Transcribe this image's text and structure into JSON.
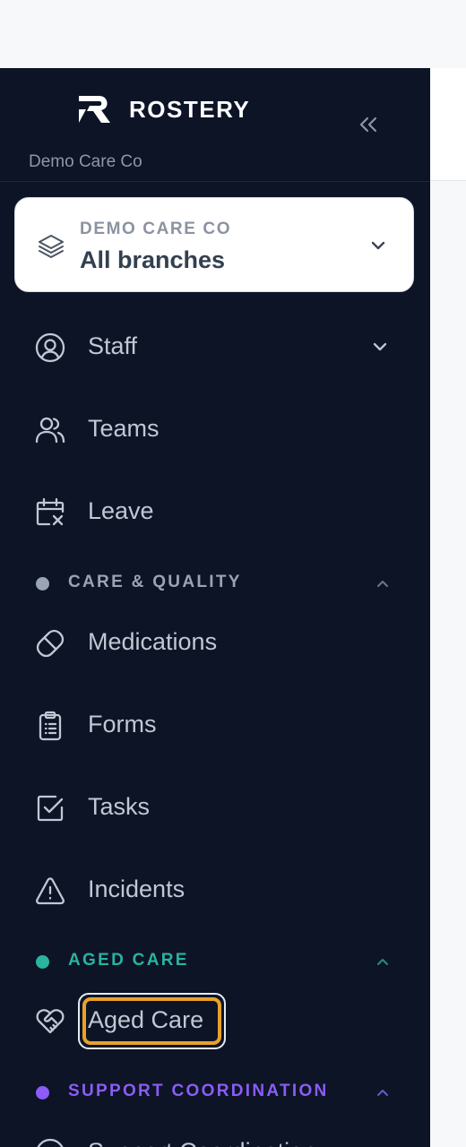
{
  "brand": {
    "name": "ROSTERY",
    "org": "Demo Care Co"
  },
  "branch_selector": {
    "caption": "DEMO CARE CO",
    "value": "All branches"
  },
  "nav_top": [
    {
      "label": "Staff",
      "icon": "user-circle-icon",
      "has_dropdown": true
    },
    {
      "label": "Teams",
      "icon": "users-icon"
    },
    {
      "label": "Leave",
      "icon": "calendar-x-icon"
    }
  ],
  "sections": [
    {
      "label": "CARE & QUALITY",
      "color": "#9aa4b2",
      "expanded": true,
      "items": [
        {
          "label": "Medications",
          "icon": "pill-icon"
        },
        {
          "label": "Forms",
          "icon": "clipboard-icon"
        },
        {
          "label": "Tasks",
          "icon": "checkbox-icon"
        },
        {
          "label": "Incidents",
          "icon": "warning-icon"
        }
      ]
    },
    {
      "label": "AGED CARE",
      "color": "#2ab3a0",
      "expanded": true,
      "items": [
        {
          "label": "Aged Care",
          "icon": "heart-handshake-icon",
          "focused": true
        }
      ]
    },
    {
      "label": "SUPPORT COORDINATION",
      "color": "#8b5cf6",
      "expanded": true,
      "items": [
        {
          "label": "Support Coordination",
          "icon": "compass-icon"
        }
      ]
    }
  ],
  "colors": {
    "sidebar_bg": "#0c1426",
    "focus_ring": "#e9a12a",
    "nav_text": "#c0c8d3"
  }
}
